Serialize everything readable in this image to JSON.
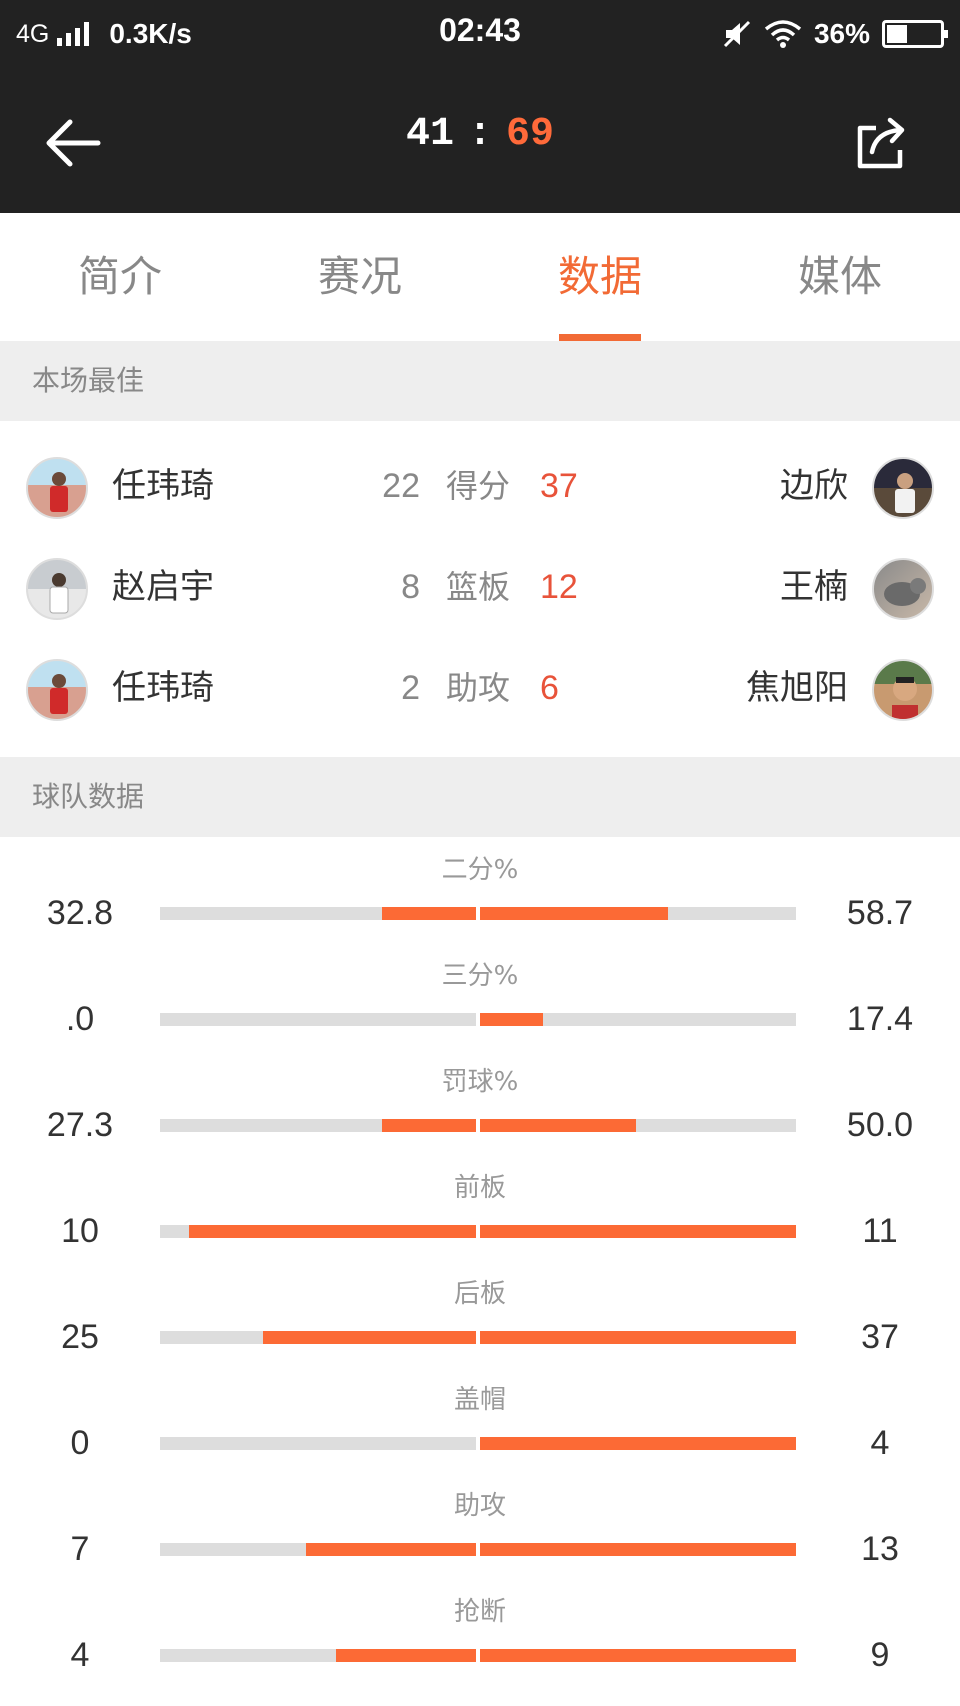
{
  "status_bar": {
    "network": "4G",
    "speed": "0.3K/s",
    "time": "02:43",
    "battery": "36%"
  },
  "header": {
    "home_score": "41",
    "separator": ":",
    "away_score": "69",
    "icons": [
      "back-arrow-icon",
      "share-icon"
    ]
  },
  "tabs": [
    {
      "label": "简介",
      "active": false
    },
    {
      "label": "赛况",
      "active": false
    },
    {
      "label": "数据",
      "active": true
    },
    {
      "label": "媒体",
      "active": false
    }
  ],
  "best": {
    "title": "本场最佳",
    "rows": [
      {
        "left_player": "任玮琦",
        "left_value": "22",
        "category": "得分",
        "right_value": "37",
        "right_player": "边欣"
      },
      {
        "left_player": "赵启宇",
        "left_value": "8",
        "category": "篮板",
        "right_value": "12",
        "right_player": "王楠"
      },
      {
        "left_player": "任玮琦",
        "left_value": "2",
        "category": "助攻",
        "right_value": "6",
        "right_player": "焦旭阳"
      }
    ]
  },
  "team": {
    "title": "球队数据",
    "stats": [
      {
        "label": "二分%",
        "left": "32.8",
        "right": "58.7",
        "left_fraction": 0.298,
        "right_fraction": 0.594
      },
      {
        "label": "三分%",
        "left": ".0",
        "right": "17.4",
        "left_fraction": 0.0,
        "right_fraction": 0.198
      },
      {
        "label": "罚球%",
        "left": "27.3",
        "right": "50.0",
        "left_fraction": 0.298,
        "right_fraction": 0.494
      },
      {
        "label": "前板",
        "left": "10",
        "right": "11",
        "left_fraction": 0.908,
        "right_fraction": 1.0
      },
      {
        "label": "后板",
        "left": "25",
        "right": "37",
        "left_fraction": 0.674,
        "right_fraction": 1.0
      },
      {
        "label": "盖帽",
        "left": "0",
        "right": "4",
        "left_fraction": 0.0,
        "right_fraction": 1.0
      },
      {
        "label": "助攻",
        "left": "7",
        "right": "13",
        "left_fraction": 0.538,
        "right_fraction": 1.0
      },
      {
        "label": "抢断",
        "left": "4",
        "right": "9",
        "left_fraction": 0.444,
        "right_fraction": 1.0
      }
    ]
  },
  "colors": {
    "accent": "#f26a35",
    "bar_fill": "#fc6a35",
    "bar_bg": "#dddddd",
    "header_bg": "#222222",
    "best_value": "#e8533a"
  }
}
